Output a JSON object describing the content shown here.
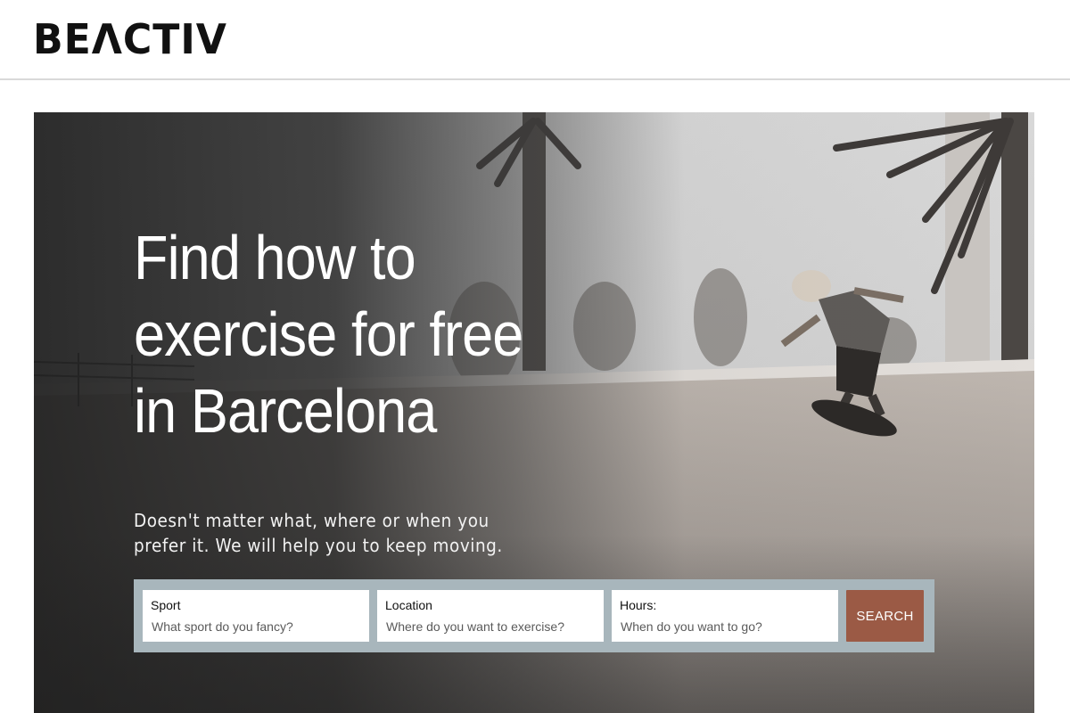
{
  "brand": {
    "logo_text": "BEΛCTIV"
  },
  "hero": {
    "headline": "Find how to exercise for free in Barcelona",
    "subtitle": "Doesn't matter what, where or when you prefer it. We will help you to keep moving.",
    "background_image": "skateboarder-in-bowl-with-palm-trees"
  },
  "search": {
    "sport": {
      "label": "Sport",
      "placeholder": "What sport do you fancy?"
    },
    "location": {
      "label": "Location",
      "placeholder": "Where do you want to exercise?"
    },
    "hours": {
      "label": "Hours:",
      "placeholder": "When do you want to go?"
    },
    "button_label": "SEARCH"
  },
  "colors": {
    "search_bar_bg": "#a8b6bc",
    "search_button": "#9b5a45",
    "header_border": "#d9d9d9"
  }
}
